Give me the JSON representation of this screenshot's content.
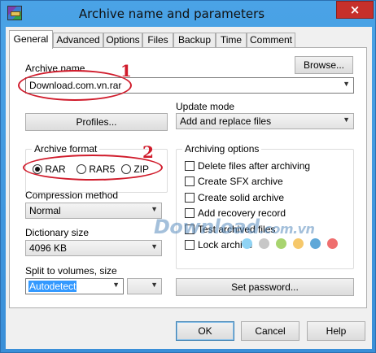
{
  "window": {
    "title": "Archive name and parameters",
    "close_glyph": "×"
  },
  "tabs": [
    "General",
    "Advanced",
    "Options",
    "Files",
    "Backup",
    "Time",
    "Comment"
  ],
  "general": {
    "archive_name_label": "Archive name",
    "browse_button": "Browse...",
    "archive_name_value": "Download.com.vn.rar",
    "profiles_button": "Profiles...",
    "update_mode_label": "Update mode",
    "update_mode_value": "Add and replace files",
    "archive_format_label": "Archive format",
    "formats": [
      {
        "label": "RAR",
        "selected": true
      },
      {
        "label": "RAR5",
        "selected": false
      },
      {
        "label": "ZIP",
        "selected": false
      }
    ],
    "compression_label": "Compression method",
    "compression_value": "Normal",
    "dictionary_label": "Dictionary size",
    "dictionary_value": "4096 KB",
    "split_label": "Split to volumes, size",
    "split_value": "Autodetect",
    "archiving_options_label": "Archiving options",
    "options": [
      {
        "label": "Delete files after archiving",
        "checked": false
      },
      {
        "label": "Create SFX archive",
        "checked": false
      },
      {
        "label": "Create solid archive",
        "checked": false
      },
      {
        "label": "Add recovery record",
        "checked": false
      },
      {
        "label": "Test archived files",
        "checked": false
      },
      {
        "label": "Lock archive",
        "checked": false
      }
    ],
    "set_password_button": "Set password..."
  },
  "footer": {
    "ok": "OK",
    "cancel": "Cancel",
    "help": "Help"
  },
  "annotations": {
    "marker_1": "1",
    "marker_2": "2",
    "color": "#d01b2b"
  },
  "watermark": {
    "text": "Download",
    "domain": ".com.vn",
    "dot_colors": [
      "#8fd3f4",
      "#c7c7c7",
      "#a8d46f",
      "#f6c86b",
      "#5fa8d8",
      "#ef6f6f"
    ]
  }
}
